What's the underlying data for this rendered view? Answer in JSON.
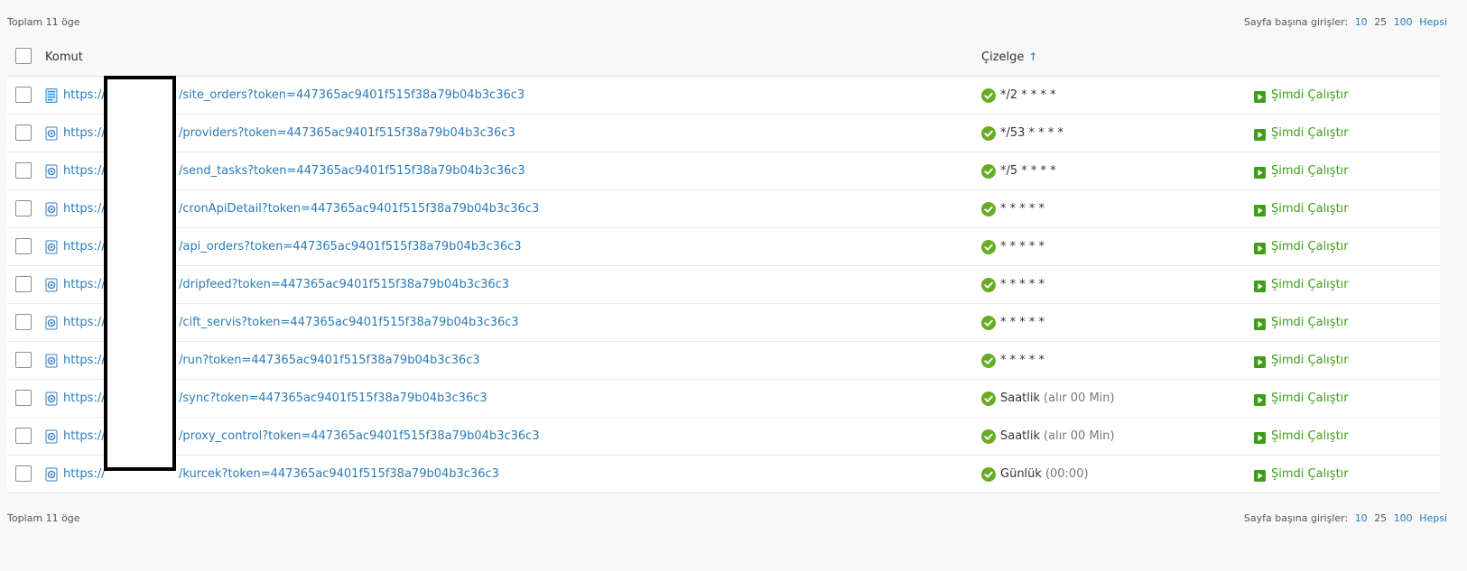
{
  "summary": {
    "total": "Toplam 11 öge"
  },
  "pagination": {
    "label": "Sayfa başına girişler:",
    "options": [
      {
        "value": "10"
      },
      {
        "value": "25"
      },
      {
        "value": "100"
      },
      {
        "value": "Hepsi"
      }
    ]
  },
  "table": {
    "headers": {
      "command": "Komut",
      "schedule": "Çizelge",
      "sort_arrow": "↑"
    },
    "rows": [
      {
        "url_prefix": "https://",
        "url_path": "/site_orders?token=447365ac9401f515f38a79b04b3c36c3",
        "schedule": "*/2 * * * *",
        "schedule_note": "",
        "action": "Şimdi Çalıştır",
        "icon": "document-icon"
      },
      {
        "url_prefix": "https://",
        "url_path": "/providers?token=447365ac9401f515f38a79b04b3c36c3",
        "schedule": "*/53 * * * *",
        "schedule_note": "",
        "action": "Şimdi Çalıştır",
        "icon": "web-link-icon"
      },
      {
        "url_prefix": "https://",
        "url_path": "/send_tasks?token=447365ac9401f515f38a79b04b3c36c3",
        "schedule": "*/5 * * * *",
        "schedule_note": "",
        "action": "Şimdi Çalıştır",
        "icon": "web-link-icon"
      },
      {
        "url_prefix": "https://",
        "url_path": "/cronApiDetail?token=447365ac9401f515f38a79b04b3c36c3",
        "schedule": "* * * * *",
        "schedule_note": "",
        "action": "Şimdi Çalıştır",
        "icon": "web-link-icon"
      },
      {
        "url_prefix": "https://",
        "url_path": "/api_orders?token=447365ac9401f515f38a79b04b3c36c3",
        "schedule": "* * * * *",
        "schedule_note": "",
        "action": "Şimdi Çalıştır",
        "icon": "web-link-icon"
      },
      {
        "url_prefix": "https://",
        "url_path": "/dripfeed?token=447365ac9401f515f38a79b04b3c36c3",
        "schedule": "* * * * *",
        "schedule_note": "",
        "action": "Şimdi Çalıştır",
        "icon": "web-link-icon"
      },
      {
        "url_prefix": "https://",
        "url_path": "/cift_servis?token=447365ac9401f515f38a79b04b3c36c3",
        "schedule": "* * * * *",
        "schedule_note": "",
        "action": "Şimdi Çalıştır",
        "icon": "web-link-icon"
      },
      {
        "url_prefix": "https://",
        "url_path": "/run?token=447365ac9401f515f38a79b04b3c36c3",
        "schedule": "* * * * *",
        "schedule_note": "",
        "action": "Şimdi Çalıştır",
        "icon": "web-link-icon"
      },
      {
        "url_prefix": "https://",
        "url_path": "/sync?token=447365ac9401f515f38a79b04b3c36c3",
        "schedule": "Saatlik",
        "schedule_note": "(alır 00 Min)",
        "action": "Şimdi Çalıştır",
        "icon": "web-link-icon"
      },
      {
        "url_prefix": "https://",
        "url_path": "/proxy_control?token=447365ac9401f515f38a79b04b3c36c3",
        "schedule": "Saatlik",
        "schedule_note": "(alır 00 Min)",
        "action": "Şimdi Çalıştır",
        "icon": "web-link-icon"
      },
      {
        "url_prefix": "https://",
        "url_path": "/kurcek?token=447365ac9401f515f38a79b04b3c36c3",
        "schedule": "Günlük",
        "schedule_note": "(00:00)",
        "action": "Şimdi Çalıştır",
        "icon": "web-link-icon"
      }
    ]
  },
  "colors": {
    "link": "#2b7bb9",
    "success": "#6aab24",
    "action": "#3f9d17"
  }
}
